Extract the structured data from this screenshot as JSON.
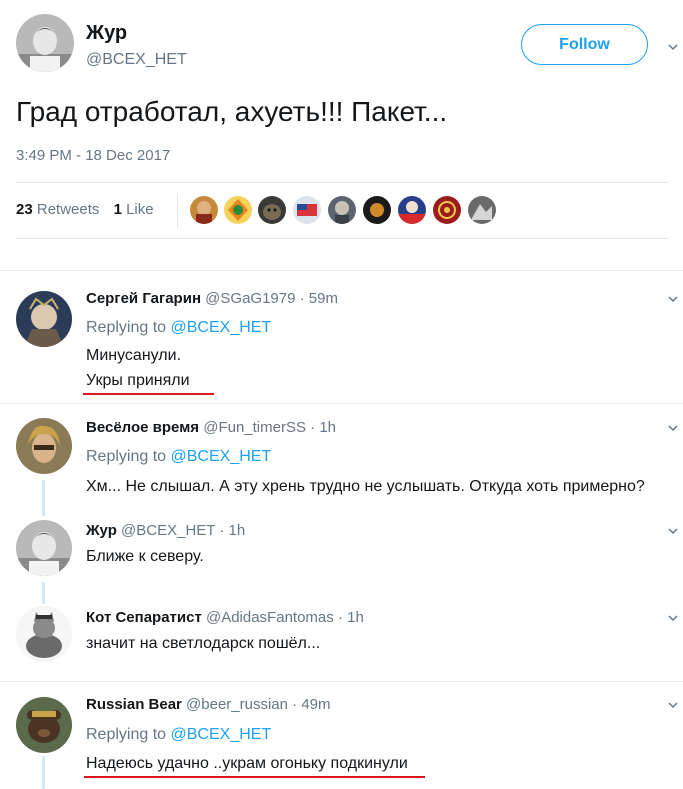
{
  "main_tweet": {
    "author_name": "Жур",
    "author_handle": "@BCEX_HET",
    "follow_label": "Follow",
    "text": "Град отработал, ахуеть!!! Пакет...",
    "timestamp": "3:49 PM - 18 Dec 2017",
    "retweets_count": "23",
    "retweets_label": "Retweets",
    "likes_count": "1",
    "likes_label": "Like"
  },
  "replies": [
    {
      "name": "Сергей Гагарин",
      "handle": "@SGaG1979",
      "dot": "·",
      "time": "59m",
      "replying_prefix": "Replying to",
      "replying_mention": "@BCEX_HET",
      "line1": "Минусанули.",
      "line2": "Укры приняли"
    },
    {
      "name": "Весёлое время",
      "handle": "@Fun_timerSS",
      "dot": "·",
      "time": "1h",
      "replying_prefix": "Replying to",
      "replying_mention": "@BCEX_HET",
      "line1": "Хм... Не слышал. А эту хрень трудно не услышать. Откуда хоть примерно?"
    },
    {
      "name": "Жур",
      "handle": "@BCEX_HET",
      "dot": "·",
      "time": "1h",
      "line1": "Ближе к северу."
    },
    {
      "name": "Кот Сепаратист",
      "handle": "@AdidasFantomas",
      "dot": "·",
      "time": "1h",
      "line1": "значит на светлодарск пошёл..."
    },
    {
      "name": "Russian Bear",
      "handle": "@beer_russian",
      "dot": "·",
      "time": "49m",
      "replying_prefix": "Replying to",
      "replying_mention": "@BCEX_HET",
      "line1": "Надеюсь удачно ..украм огоньку подкинули"
    }
  ],
  "colors": {
    "accent": "#1da1f2",
    "secondary_text": "#657786",
    "highlight_underline": "#e0191f"
  }
}
